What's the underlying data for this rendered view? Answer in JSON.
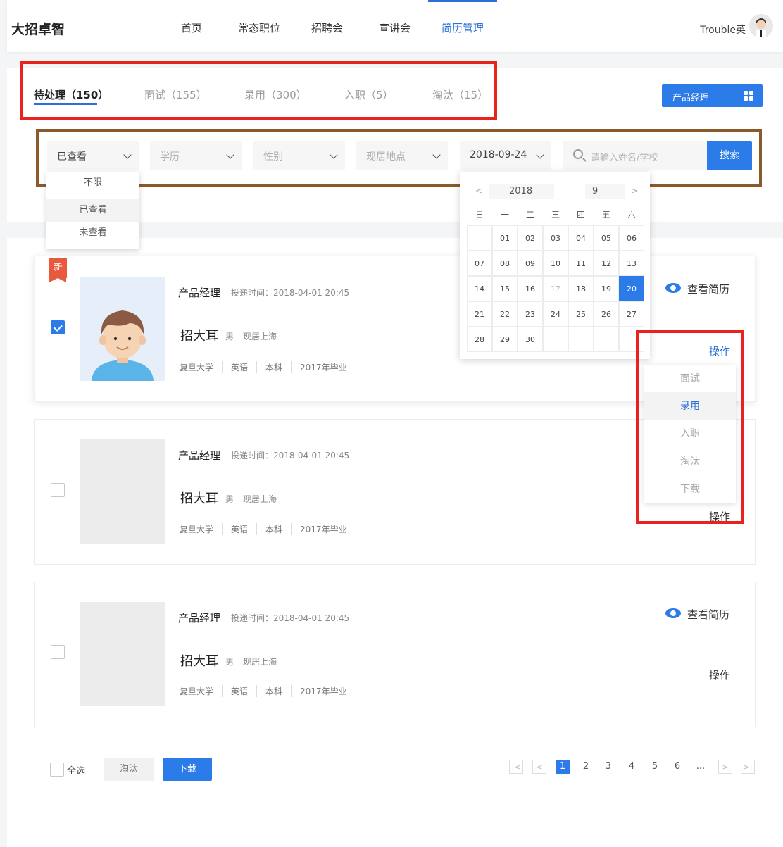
{
  "header": {
    "logo": "大招卓智",
    "nav": [
      "首页",
      "常态职位",
      "招聘会",
      "宣讲会",
      "简历管理"
    ],
    "active_nav": "简历管理",
    "username": "Trouble英"
  },
  "status_tabs": [
    {
      "label": "待处理（150）",
      "active": true
    },
    {
      "label": "面试（155）",
      "active": false
    },
    {
      "label": "录用（300）",
      "active": false
    },
    {
      "label": "入职（5）",
      "active": false
    },
    {
      "label": "淘汰（15）",
      "active": false
    }
  ],
  "position_filter": {
    "label": "产品经理",
    "icon": "grid-icon"
  },
  "filters": {
    "viewed": "已查看",
    "education": "学历",
    "gender": "性别",
    "location": "现居地点",
    "date": "2018-09-24",
    "search_placeholder": "请输入姓名/学校",
    "search_button": "搜索"
  },
  "viewed_dropdown": {
    "options": [
      "不限",
      "已查看",
      "未查看"
    ],
    "selected": "已查看"
  },
  "calendar": {
    "year": "2018",
    "month": "9",
    "prev": "<",
    "next": ">",
    "weekdays": [
      "日",
      "一",
      "二",
      "三",
      "四",
      "五",
      "六"
    ],
    "days": [
      "01",
      "02",
      "03",
      "04",
      "05",
      "06",
      "07",
      "08",
      "09",
      "10",
      "11",
      "12",
      "13",
      "14",
      "15",
      "16",
      "17",
      "18",
      "19",
      "20",
      "21",
      "22",
      "23",
      "24",
      "25",
      "26",
      "27",
      "28",
      "29",
      "30"
    ],
    "selected": "20"
  },
  "new_tag": "新",
  "cards": [
    {
      "title": "产品经理",
      "time": "投递时间：2018-04-01 20:45",
      "name": "招大耳",
      "gender": "男",
      "location": "现居上海",
      "school": "复旦大学",
      "major": "英语",
      "degree": "本科",
      "grad": "2017年毕业",
      "view": "查看简历",
      "op": "操作",
      "checked": true
    },
    {
      "title": "产品经理",
      "time": "投递时间：2018-04-01 20:45",
      "name": "招大耳",
      "gender": "男",
      "location": "现居上海",
      "school": "复旦大学",
      "major": "英语",
      "degree": "本科",
      "grad": "2017年毕业",
      "op": "操作",
      "checked": false
    },
    {
      "title": "产品经理",
      "time": "投递时间：2018-04-01 20:45",
      "name": "招大耳",
      "gender": "男",
      "location": "现居上海",
      "school": "复旦大学",
      "major": "英语",
      "degree": "本科",
      "grad": "2017年毕业",
      "view": "查看简历",
      "op": "操作",
      "checked": false
    }
  ],
  "op_menu": {
    "items": [
      "面试",
      "录用",
      "入职",
      "淘汰",
      "下载"
    ],
    "selected": "录用"
  },
  "bottom": {
    "select_all": "全选",
    "reject": "淘汰",
    "download": "下载"
  },
  "pagination": {
    "first": "|<",
    "prev": "<",
    "pages": [
      "1",
      "2",
      "3",
      "4",
      "5",
      "6"
    ],
    "ellipsis": "...",
    "next": ">",
    "last": ">|",
    "current": "1"
  },
  "colors": {
    "primary": "#2b7be8",
    "highlight_red": "#e8231e",
    "highlight_brown": "#8b5a2b",
    "new_tag": "#e8593e"
  }
}
